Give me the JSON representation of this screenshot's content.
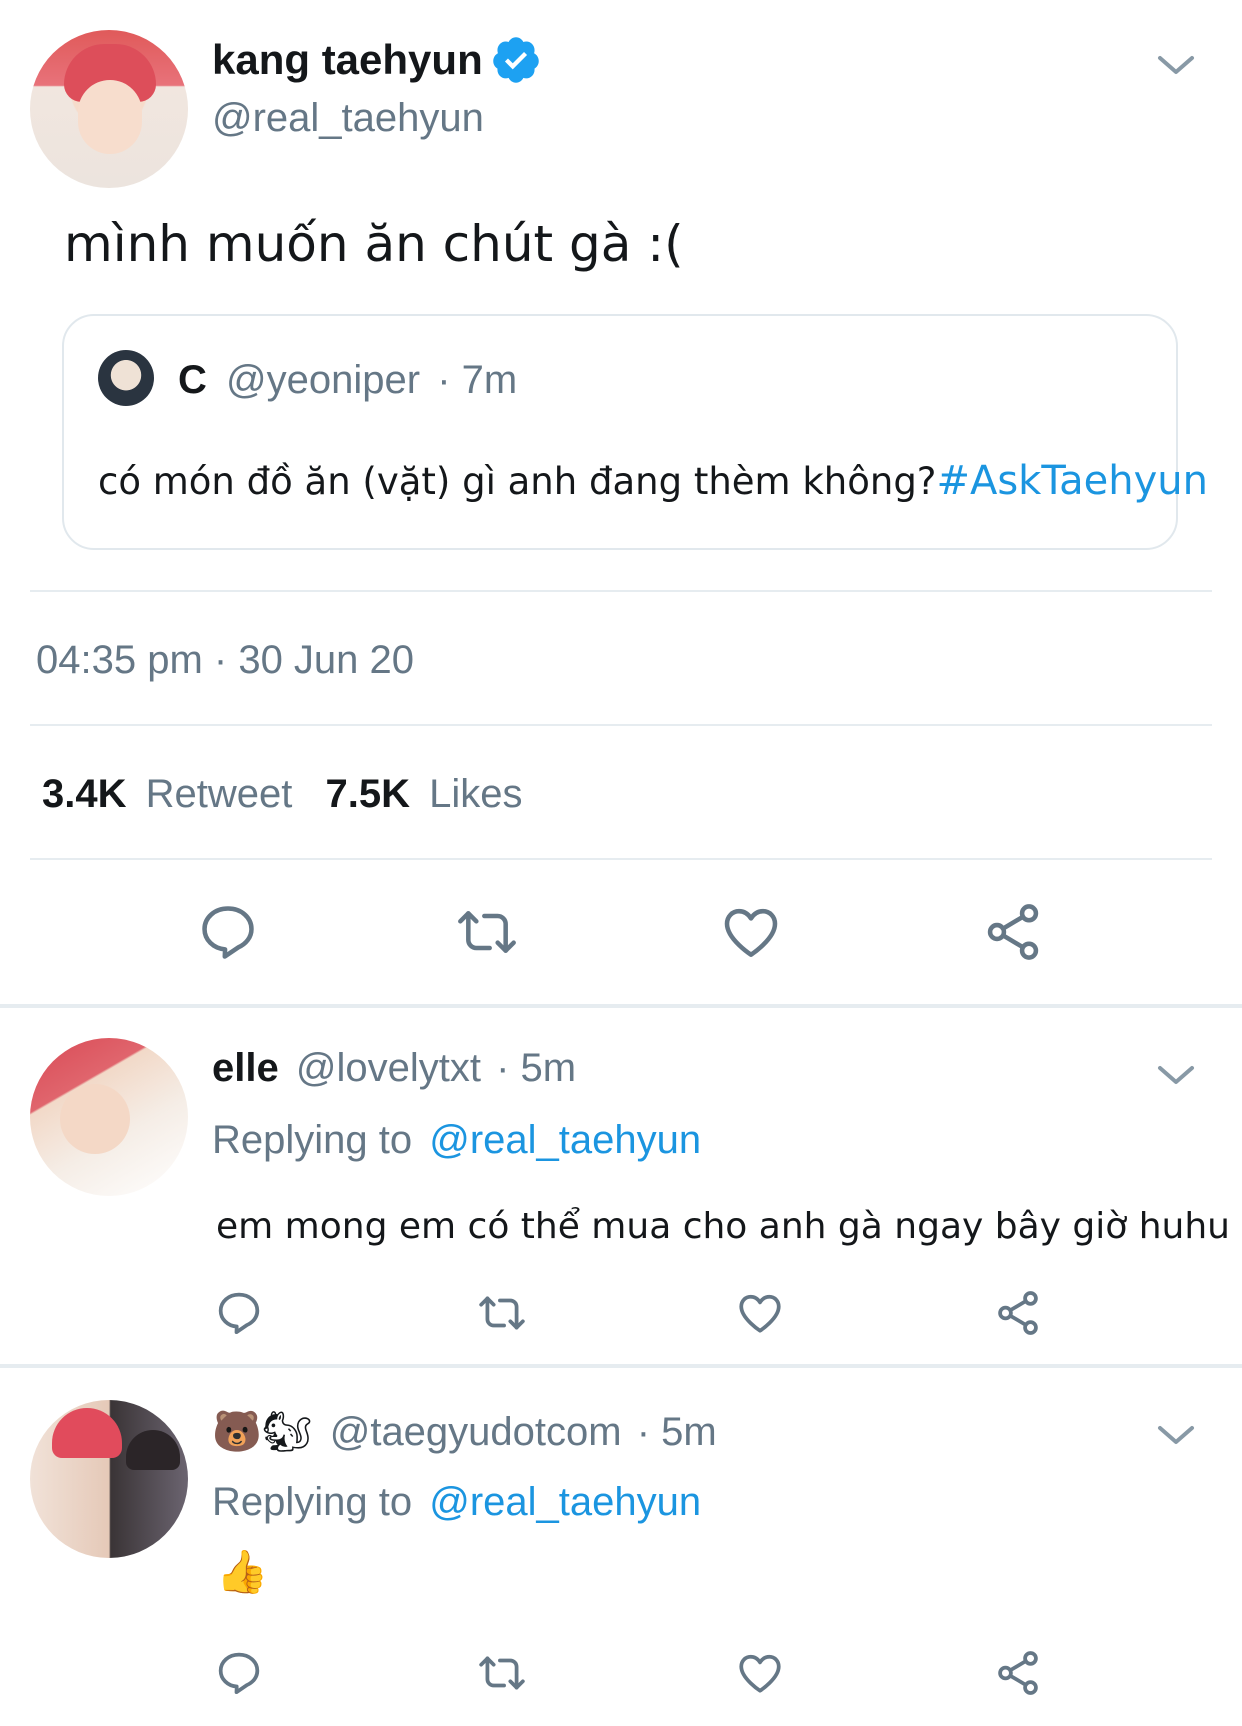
{
  "main_tweet": {
    "display_name": "kang taehyun",
    "handle": "@real_taehyun",
    "text": "mình muốn ăn chút gà :(",
    "quoted": {
      "name": "C",
      "handle": "@yeoniper",
      "time": "· 7m",
      "text": "có món đồ ăn (vặt) gì anh đang thèm không?",
      "hashtag": "#AskTaehyun"
    },
    "timestamp": "04:35 pm · 30 Jun 20",
    "retweet_count": "3.4K",
    "retweet_label": "Retweet",
    "like_count": "7.5K",
    "like_label": "Likes"
  },
  "replies": [
    {
      "name": "elle",
      "handle": "@lovelytxt",
      "time": "· 5m",
      "replying_label": "Replying to",
      "replying_handle": "@real_taehyun",
      "text": "em mong em có thể mua cho anh gà ngay bây giờ huhu"
    },
    {
      "name": "🐻🐿",
      "handle": "@taegyudotcom",
      "time": "· 5m",
      "replying_label": "Replying to",
      "replying_handle": "@real_taehyun",
      "text": "👍"
    }
  ],
  "icons": [
    "verified-badge-icon",
    "chevron-down-icon",
    "reply-icon",
    "retweet-icon",
    "like-icon",
    "share-icon"
  ],
  "colors": {
    "accent": "#1b95e0",
    "secondary_text": "#657786",
    "divider": "#e6ecf0"
  }
}
